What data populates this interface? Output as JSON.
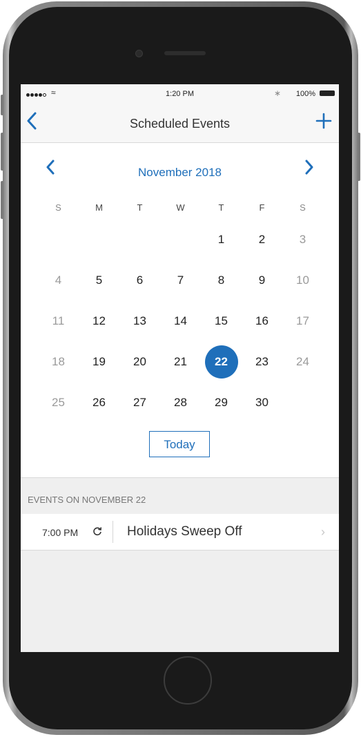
{
  "status": {
    "time": "1:20 PM",
    "battery": "100%"
  },
  "nav": {
    "back_icon": "chevron-left-icon",
    "title": "Scheduled Events",
    "add_icon": "plus-icon"
  },
  "calendar": {
    "month": "November 2018",
    "weekdays": [
      "S",
      "M",
      "T",
      "W",
      "T",
      "F",
      "S"
    ],
    "weeks": [
      [
        "",
        "",
        "",
        "",
        "1",
        "2",
        "3"
      ],
      [
        "4",
        "5",
        "6",
        "7",
        "8",
        "9",
        "10"
      ],
      [
        "11",
        "12",
        "13",
        "14",
        "15",
        "16",
        "17"
      ],
      [
        "18",
        "19",
        "20",
        "21",
        "22",
        "23",
        "24"
      ],
      [
        "25",
        "26",
        "27",
        "28",
        "29",
        "30",
        ""
      ]
    ],
    "selected": "22",
    "today_label": "Today"
  },
  "events": {
    "header": "EVENTS ON NOVEMBER 22",
    "items": [
      {
        "time": "7:00 PM",
        "title": "Holidays Sweep Off",
        "repeat_icon": "repeat-icon"
      }
    ]
  },
  "colors": {
    "accent": "#1f6fba"
  }
}
